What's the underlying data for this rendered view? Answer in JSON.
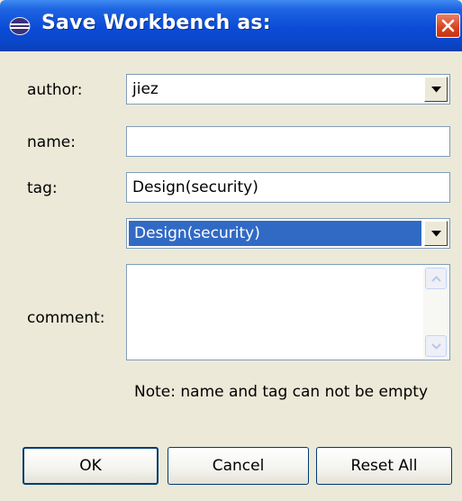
{
  "window": {
    "title": "Save Workbench as:",
    "icon": "eclipse-icon",
    "close_icon": "close-icon"
  },
  "form": {
    "author": {
      "label": "author:",
      "value": "jiez"
    },
    "name": {
      "label": "name:",
      "value": ""
    },
    "tag": {
      "label": "tag:",
      "value": "Design(security)",
      "dropdown_value": "Design(security)"
    },
    "comment": {
      "label": "comment:",
      "value": ""
    }
  },
  "note": "Note: name and tag can not be empty",
  "buttons": {
    "ok": "OK",
    "cancel": "Cancel",
    "reset": "Reset All"
  },
  "colors": {
    "titlebar": "#0b4bd6",
    "selection": "#316AC5",
    "dialog_bg": "#ECE9D8",
    "close": "#d9411d"
  }
}
